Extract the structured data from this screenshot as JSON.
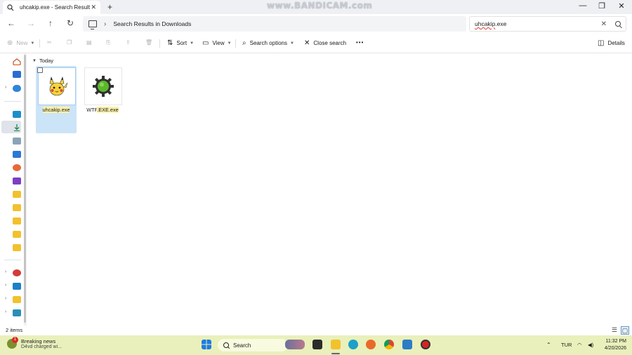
{
  "window": {
    "tab_title": "uhcakip.exe - Search Results i",
    "new_tab": "+",
    "tab_close": "✕",
    "watermark": "www.BANDICAM.com",
    "minimize": "—",
    "restore": "❐",
    "close": "✕"
  },
  "address": {
    "back": "←",
    "forward": "→",
    "up": "↑",
    "refresh": "↻",
    "separator": "›",
    "breadcrumb": "Search Results in Downloads",
    "search_value_part1": "uhcakip",
    "search_value_part2": ".exe",
    "search_clear": "✕"
  },
  "commands": {
    "new": "New",
    "sort": "Sort",
    "view": "View",
    "search_options": "Search options",
    "close_search": "Close search",
    "more": "•••",
    "details": "Details"
  },
  "content": {
    "group_label": "Today",
    "files": [
      {
        "name": "uhcakip.exe",
        "selected": true,
        "icon": "pikachu-icon"
      },
      {
        "name_plain": "WTF",
        "name_highlight": ".EXE.exe",
        "selected": false,
        "icon": "gear-icon"
      }
    ]
  },
  "status": {
    "item_count": "2 items"
  },
  "taskbar": {
    "news_title": "Breaking news",
    "news_subtitle": "D4vd charged wi...",
    "news_badge": "1",
    "search_label": "Search",
    "language": "TUR",
    "time": "11:32 PM",
    "date": "4/20/2026"
  },
  "colors": {
    "accent": "#0067c0",
    "selection": "#cce4f7",
    "taskbar": "#e9f0bb",
    "highlight": "#fbf1a9"
  }
}
